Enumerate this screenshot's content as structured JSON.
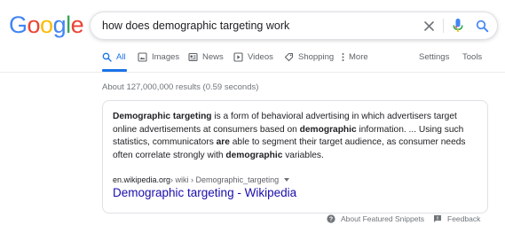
{
  "logo": {
    "letters": [
      {
        "ch": "G",
        "color": "#4285F4"
      },
      {
        "ch": "o",
        "color": "#EA4335"
      },
      {
        "ch": "o",
        "color": "#FBBC05"
      },
      {
        "ch": "g",
        "color": "#4285F4"
      },
      {
        "ch": "l",
        "color": "#34A853"
      },
      {
        "ch": "e",
        "color": "#EA4335"
      }
    ]
  },
  "search": {
    "query": "how does demographic targeting work",
    "clear_icon": "close-icon",
    "mic_icon": "mic-icon",
    "search_icon": "search-icon"
  },
  "tabs": {
    "all": "All",
    "images": "Images",
    "news": "News",
    "videos": "Videos",
    "shopping": "Shopping",
    "more": "More",
    "settings": "Settings",
    "tools": "Tools"
  },
  "stats": "About 127,000,000 results (0.59 seconds)",
  "snippet": {
    "parts": [
      {
        "text": "Demographic targeting",
        "bold": true
      },
      {
        "text": " is a form of behavioral advertising in which advertisers target online advertisements at consumers based on ",
        "bold": false
      },
      {
        "text": "demographic",
        "bold": true
      },
      {
        "text": " information. ... Using such statistics, communicators ",
        "bold": false
      },
      {
        "text": "are",
        "bold": true
      },
      {
        "text": " able to segment their target audience, as consumer needs often correlate strongly with ",
        "bold": false
      },
      {
        "text": "demographic",
        "bold": true
      },
      {
        "text": " variables.",
        "bold": false
      }
    ],
    "cite_domain": "en.wikipedia.org",
    "cite_path": " › wiki › Demographic_targeting",
    "link_title": "Demographic targeting - Wikipedia"
  },
  "footer": {
    "about": "About Featured Snippets",
    "feedback": "Feedback"
  },
  "colors": {
    "accent": "#1a73e8",
    "link": "#1a0dab"
  }
}
